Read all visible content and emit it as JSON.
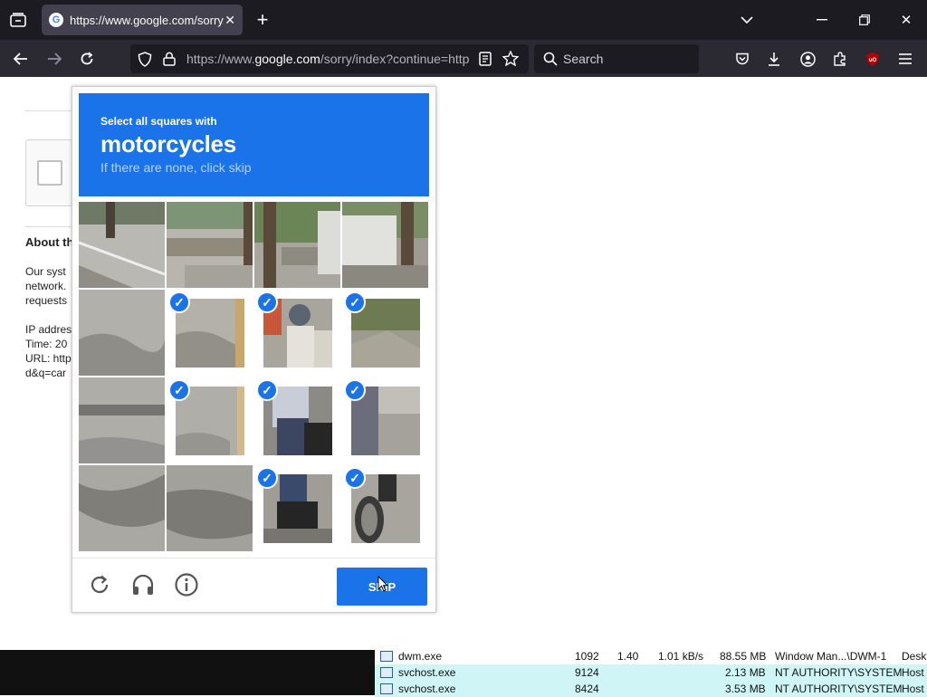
{
  "browser": {
    "tab": {
      "title": "https://www.google.com/sorry/index?continue=https",
      "favicon": "G"
    },
    "url": {
      "prefix": "https://www.",
      "domain": "google.com",
      "path": "/sorry/index?continue=http"
    },
    "search_placeholder": "Search"
  },
  "background_page": {
    "about_heading": "About th",
    "para1": [
      "Our syst",
      "network.",
      "requests"
    ],
    "para2": [
      "IP addres",
      "Time: 20",
      "URL: http",
      "d&q=car"
    ]
  },
  "captcha": {
    "instruction": "Select all squares with",
    "target": "motorcycles",
    "hint": "If there are none, click skip",
    "accent_color": "#1a73e8",
    "selected_cells": [
      5,
      6,
      7,
      9,
      10,
      11,
      14,
      15
    ],
    "skip_label": "SKIP",
    "icons": [
      "reload-icon",
      "audio-icon",
      "info-icon"
    ]
  },
  "task_manager": {
    "rows": [
      {
        "name": "dwm.exe",
        "pid": "1092",
        "cpu": "1.40",
        "net": "1.01 kB/s",
        "mem": "88.55 MB",
        "user": "Window Man...\\DWM-1",
        "desc": "Deskt"
      },
      {
        "name": "svchost.exe",
        "pid": "9124",
        "cpu": "",
        "net": "",
        "mem": "2.13 MB",
        "user": "NT AUTHORITY\\SYSTEM",
        "desc": "Host"
      },
      {
        "name": "svchost.exe",
        "pid": "8424",
        "cpu": "",
        "net": "",
        "mem": "3.53 MB",
        "user": "NT AUTHORITY\\SYSTEM",
        "desc": "Host"
      }
    ]
  }
}
